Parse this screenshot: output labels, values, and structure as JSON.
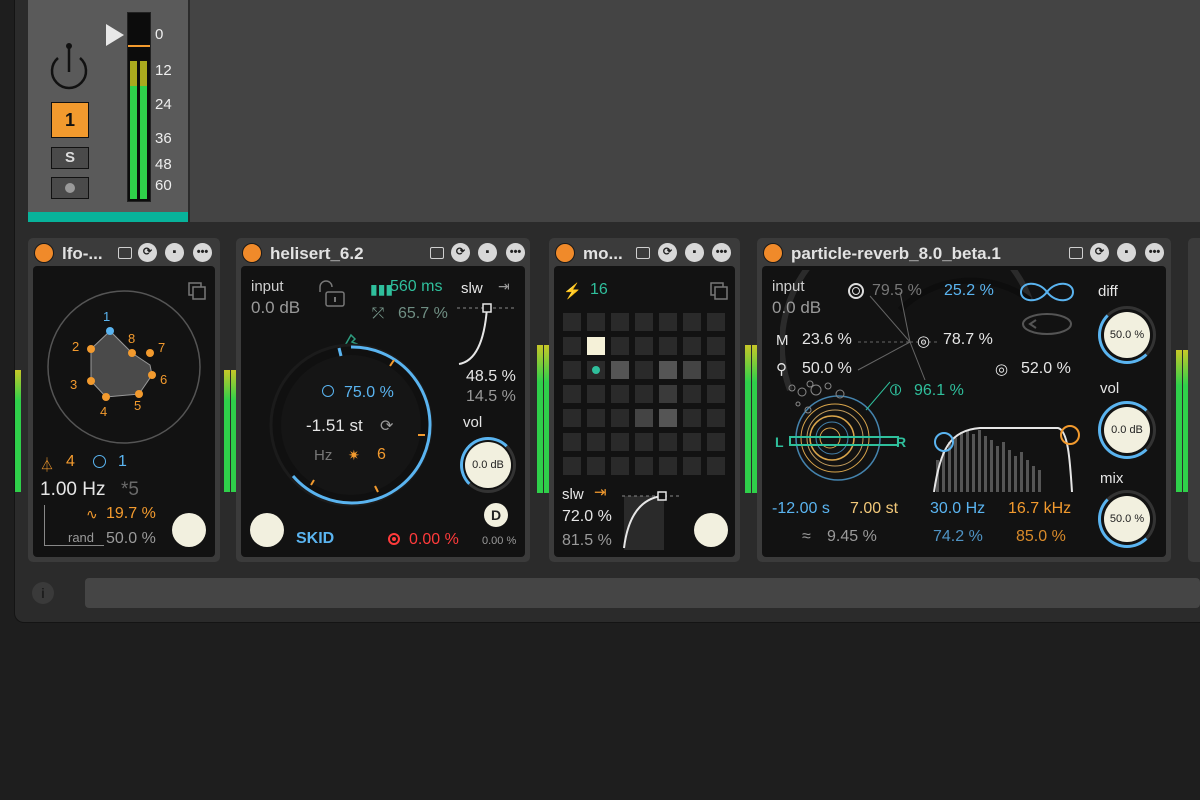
{
  "track": {
    "number": "1",
    "solo": "S",
    "meter_scale": [
      "0",
      "12",
      "24",
      "36",
      "48",
      "60"
    ]
  },
  "colors": {
    "accent_orange": "#f08a2a",
    "accent_teal": "#08b39b",
    "blue": "#5ab4f0",
    "red": "#ff3b3b"
  },
  "lfo": {
    "title": "lfo-...",
    "points": [
      "1",
      "2",
      "3",
      "4",
      "5",
      "6",
      "7",
      "8"
    ],
    "steps": "4",
    "loop": "1",
    "rate": "1.00 Hz",
    "mult": "*5",
    "wave_amount": "19.7 %",
    "rand_label": "rand",
    "rand_value": "50.0 %"
  },
  "helisert": {
    "title": "helisert_6.2",
    "input_label": "input",
    "input_value": "0.0 dB",
    "time": "560 ms",
    "feedback": "65.7 %",
    "slw_label": "slw",
    "slw_value": "48.5 %",
    "slw_value2": "14.5 %",
    "dial_percent": "75.0 %",
    "pitch": "-1.51 st",
    "hz": "Hz",
    "voices": "6",
    "vol_label": "vol",
    "vol_value": "0.0 dB",
    "mode": "SKID",
    "rec_value": "0.00 %",
    "d_label": "D",
    "d_value": "0.00 %"
  },
  "mod": {
    "title": "mo...",
    "steps": "16",
    "slw_label": "slw",
    "slw_value": "72.0 %",
    "slw_value2": "81.5 %"
  },
  "particle": {
    "title": "particle-reverb_8.0_beta.1",
    "input_label": "input",
    "input_value": "0.0 dB",
    "param_a": "79.5 %",
    "param_b": "25.2 %",
    "param_c": "23.6 %",
    "param_d": "78.7 %",
    "param_e": "50.0 %",
    "param_f": "52.0 %",
    "param_g": "96.1 %",
    "l_label": "L",
    "r_label": "R",
    "diff_label": "diff",
    "diff_value": "50.0 %",
    "vol_label": "vol",
    "vol_value": "0.0 dB",
    "mix_label": "mix",
    "mix_value": "50.0 %",
    "decay": "-12.00 s",
    "pitch": "7.00 st",
    "low_cut": "30.0 Hz",
    "high_cut": "16.7 kHz",
    "mod_amount": "9.45 %",
    "low_amount": "74.2 %",
    "high_amount": "85.0 %"
  }
}
